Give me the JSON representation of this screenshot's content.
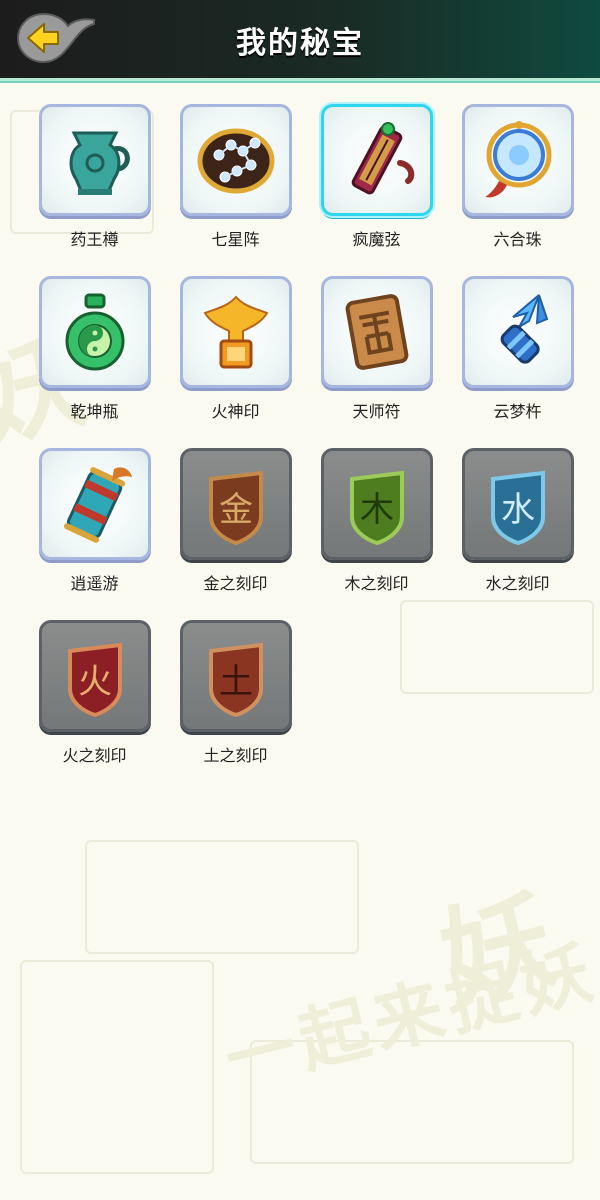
{
  "header": {
    "title": "我的秘宝"
  },
  "treasures": [
    {
      "name": "药王樽",
      "icon": "jade-vessel-icon",
      "state": "unlocked"
    },
    {
      "name": "七星阵",
      "icon": "seven-star-disc-icon",
      "state": "unlocked"
    },
    {
      "name": "疯魔弦",
      "icon": "crimson-scroll-icon",
      "state": "selected"
    },
    {
      "name": "六合珠",
      "icon": "orb-ring-icon",
      "state": "unlocked"
    },
    {
      "name": "乾坤瓶",
      "icon": "yin-yang-bottle-icon",
      "state": "unlocked"
    },
    {
      "name": "火神印",
      "icon": "phoenix-seal-icon",
      "state": "unlocked"
    },
    {
      "name": "天师符",
      "icon": "talisman-tablet-icon",
      "state": "unlocked"
    },
    {
      "name": "云梦杵",
      "icon": "blue-crystal-pestle-icon",
      "state": "unlocked"
    },
    {
      "name": "逍遥游",
      "icon": "scroll-roll-icon",
      "state": "unlocked"
    },
    {
      "name": "金之刻印",
      "icon": "metal-rune-shield-icon",
      "state": "locked",
      "rune": "金"
    },
    {
      "name": "木之刻印",
      "icon": "wood-rune-shield-icon",
      "state": "locked",
      "rune": "木"
    },
    {
      "name": "水之刻印",
      "icon": "water-rune-shield-icon",
      "state": "locked",
      "rune": "水"
    },
    {
      "name": "火之刻印",
      "icon": "fire-rune-shield-icon",
      "state": "locked",
      "rune": "火"
    },
    {
      "name": "土之刻印",
      "icon": "earth-rune-shield-icon",
      "state": "locked",
      "rune": "土"
    }
  ],
  "colors": {
    "selected_border": "#2fd6ee",
    "card_border": "#a7b6df",
    "back_arrow": "#ffd21f"
  }
}
